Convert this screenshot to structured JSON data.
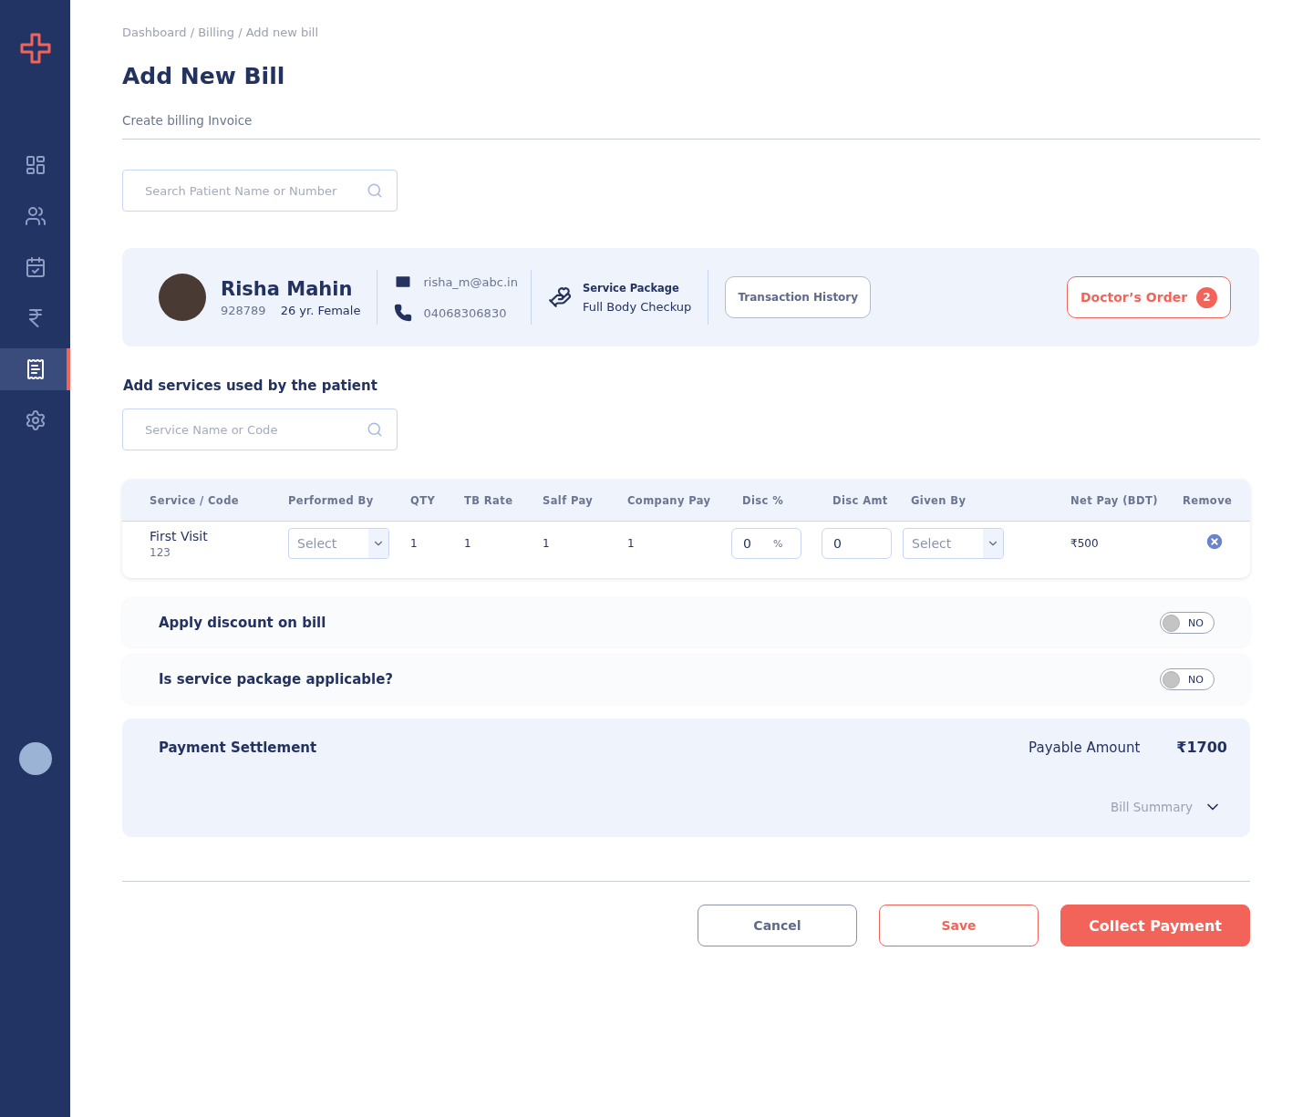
{
  "sidebar": {
    "items": [
      {
        "kind": "dashboard",
        "selected": false
      },
      {
        "kind": "patients",
        "selected": false
      },
      {
        "kind": "calendar",
        "selected": false
      },
      {
        "kind": "rupee",
        "selected": false
      },
      {
        "kind": "bill",
        "selected": true
      },
      {
        "kind": "settings",
        "selected": false
      }
    ]
  },
  "breadcrumb": "Dashboard / Billing / Add new bill",
  "title": "Add New Bill",
  "subtitle": "Create billing Invoice",
  "patient_search": {
    "placeholder": "Search Patient Name or Number"
  },
  "patient": {
    "name": "Risha Mahin",
    "id": "928789",
    "age_gender": "26 yr. Female",
    "email": "risha_m@abc.in",
    "phone": "04068306830",
    "package_label": "Service Package",
    "package": "Full Body Checkup",
    "history_button": "Transaction History",
    "orders_button": "Doctor’s Order",
    "orders_count": "2"
  },
  "services_heading": "Add services used by the patient",
  "service_search": {
    "placeholder": "Service Name or Code"
  },
  "table": {
    "columns": [
      "Service / Code",
      "Performed By",
      "QTY",
      "TB Rate",
      "Salf Pay",
      "Company Pay",
      "Disc %",
      "Disc Amt",
      "Given By",
      "Net Pay (BDT)",
      "Remove"
    ],
    "rows": [
      {
        "service": "First Visit",
        "code": "123",
        "performed_by": "Select",
        "qty": "1",
        "tb_rate": "1",
        "salf_pay": "1",
        "company_pay": "1",
        "disc_pct": "0",
        "pct_sign": "%",
        "disc_amt": "0",
        "given_by": "Select",
        "net_pay": "₹500"
      }
    ]
  },
  "options": [
    {
      "label": "Apply discount on bill",
      "on": false,
      "state_text": "NO"
    },
    {
      "label": "Is service package applicable?",
      "on": false,
      "state_text": "NO"
    }
  ],
  "payment": {
    "title": "Payment Settlement",
    "payable_label": "Payable Amount",
    "payable": "₹1700",
    "summary": "Bill Summary",
    "expanded": false
  },
  "buttons": [
    {
      "label": "Cancel",
      "kind": "outline"
    },
    {
      "label": "Save",
      "kind": "danger-outline"
    },
    {
      "label": "Collect Payment",
      "kind": "primary"
    }
  ]
}
